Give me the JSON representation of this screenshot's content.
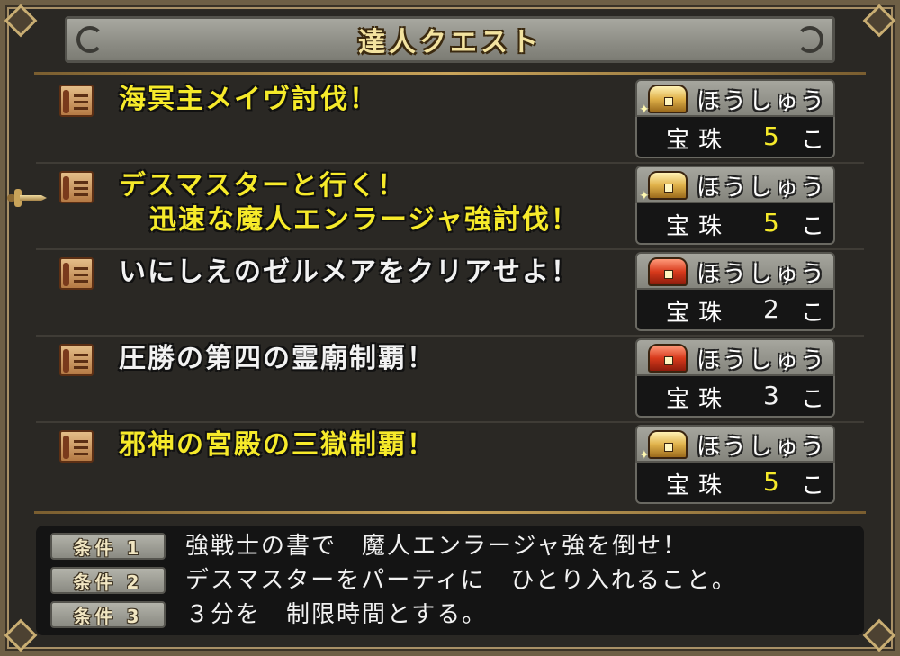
{
  "title": "達人クエスト",
  "quests": [
    {
      "name_line1": "海冥主メイヴ討伐！",
      "name_line2": "",
      "name_color": "yellow",
      "reward_label": "ほうしゅう",
      "chest": "gold",
      "reward_item": "宝珠",
      "reward_count": "5",
      "reward_unit": "こ",
      "count_color": "yellow"
    },
    {
      "name_line1": "デスマスターと行く！",
      "name_line2": "迅速な魔人エンラージャ強討伐！",
      "name_color": "yellow",
      "reward_label": "ほうしゅう",
      "chest": "gold",
      "reward_item": "宝珠",
      "reward_count": "5",
      "reward_unit": "こ",
      "count_color": "yellow"
    },
    {
      "name_line1": "いにしえのゼルメアをクリアせよ！",
      "name_line2": "",
      "name_color": "white",
      "reward_label": "ほうしゅう",
      "chest": "red",
      "reward_item": "宝珠",
      "reward_count": "2",
      "reward_unit": "こ",
      "count_color": "white"
    },
    {
      "name_line1": "圧勝の第四の霊廟制覇！",
      "name_line2": "",
      "name_color": "white",
      "reward_label": "ほうしゅう",
      "chest": "red",
      "reward_item": "宝珠",
      "reward_count": "3",
      "reward_unit": "こ",
      "count_color": "white"
    },
    {
      "name_line1": "邪神の宮殿の三獄制覇！",
      "name_line2": "",
      "name_color": "yellow",
      "reward_label": "ほうしゅう",
      "chest": "gold",
      "reward_item": "宝珠",
      "reward_count": "5",
      "reward_unit": "こ",
      "count_color": "yellow"
    }
  ],
  "conditions": [
    {
      "tag": "条件 1",
      "text": "強戦士の書で　魔人エンラージャ強を倒せ！"
    },
    {
      "tag": "条件 2",
      "text": "デスマスターをパーティに　ひとり入れること。"
    },
    {
      "tag": "条件 3",
      "text": "３分を　制限時間とする。"
    }
  ],
  "colors": {
    "quest_yellow": "#f6ea2a",
    "quest_white": "#f2f2f2",
    "gold_trim": "#c9a45a",
    "panel_bg": "#2a2824"
  },
  "icons": {
    "quest": "scroll-icon",
    "reward_gold": "gold-chest-icon",
    "reward_red": "red-chest-icon",
    "cursor": "sword-cursor-icon"
  }
}
